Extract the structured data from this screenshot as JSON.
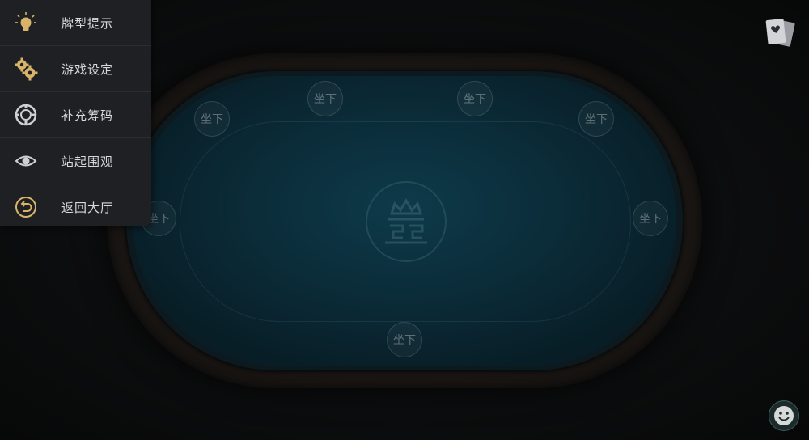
{
  "menu": {
    "items": [
      {
        "label": "牌型提示",
        "icon": "lightbulb-icon"
      },
      {
        "label": "游戏设定",
        "icon": "gears-icon"
      },
      {
        "label": "补充筹码",
        "icon": "poker-chip-icon"
      },
      {
        "label": "站起围观",
        "icon": "eye-icon"
      },
      {
        "label": "返回大厅",
        "icon": "return-icon"
      }
    ]
  },
  "seats": [
    {
      "label": "坐下"
    },
    {
      "label": "坐下"
    },
    {
      "label": "坐下"
    },
    {
      "label": "坐下"
    },
    {
      "label": "坐下"
    },
    {
      "label": "坐下"
    },
    {
      "label": "坐下"
    }
  ],
  "colors": {
    "menu_icon_gold": "#d8b46a",
    "felt": "#0b2c39",
    "menu_bg": "#1e2024"
  },
  "toolbar": {
    "card_icon": "playing-cards-icon",
    "emoji_icon": "smiley-icon"
  }
}
